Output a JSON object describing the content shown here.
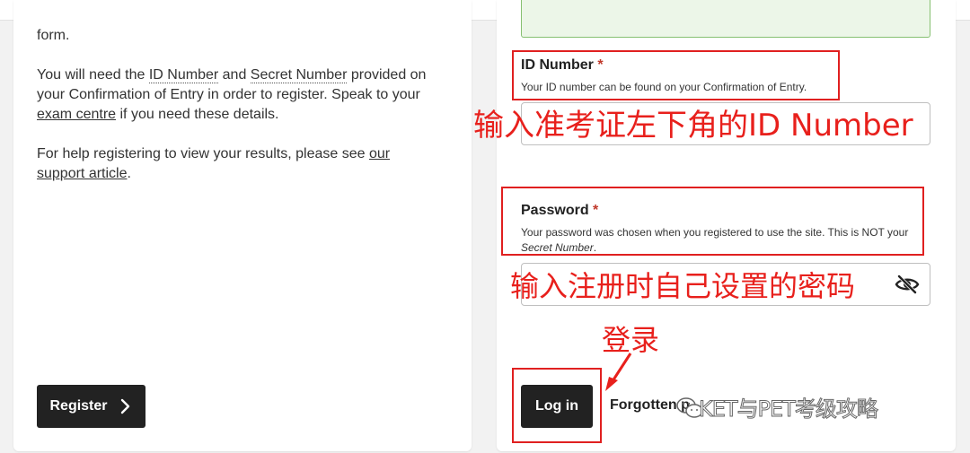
{
  "left_panel": {
    "cut_line_tail": "form.",
    "para1": {
      "t1": "You will need the ",
      "id_number": "ID Number",
      "t2": " and ",
      "secret_number": "Secret Number",
      "t3": " provided on",
      "line2": "your Confirmation of Entry in order to register. Speak to your",
      "exam_centre": "exam centre",
      "t4": " if you need these details."
    },
    "para2": {
      "t1": "For help registering to view your results, please see ",
      "link_a": "our",
      "link_b": "support article",
      "t2": "."
    },
    "register_label": "Register"
  },
  "login_form": {
    "id_field": {
      "label": "ID Number",
      "required_mark": "*",
      "hint": "Your ID number can be found on your Confirmation of Entry.",
      "value": ""
    },
    "password_field": {
      "label": "Password",
      "required_mark": "*",
      "hint": "Your password was chosen when you registered to use the site. This is NOT your",
      "hint_italic": "Secret Number",
      "hint_end": ".",
      "value": ""
    },
    "login_label": "Log in",
    "forgotten_label": "Forgotten p"
  },
  "annotations": {
    "id_note": "输入准考证左下角的ID Number",
    "password_note": "输入注册时自己设置的密码",
    "login_note": "登录"
  },
  "watermark": "KET与PET考级攻略",
  "colors": {
    "annotation_red": "#e8201c",
    "button_dark": "#222222",
    "success_green": "#86c071",
    "required_red": "#c0392b"
  }
}
